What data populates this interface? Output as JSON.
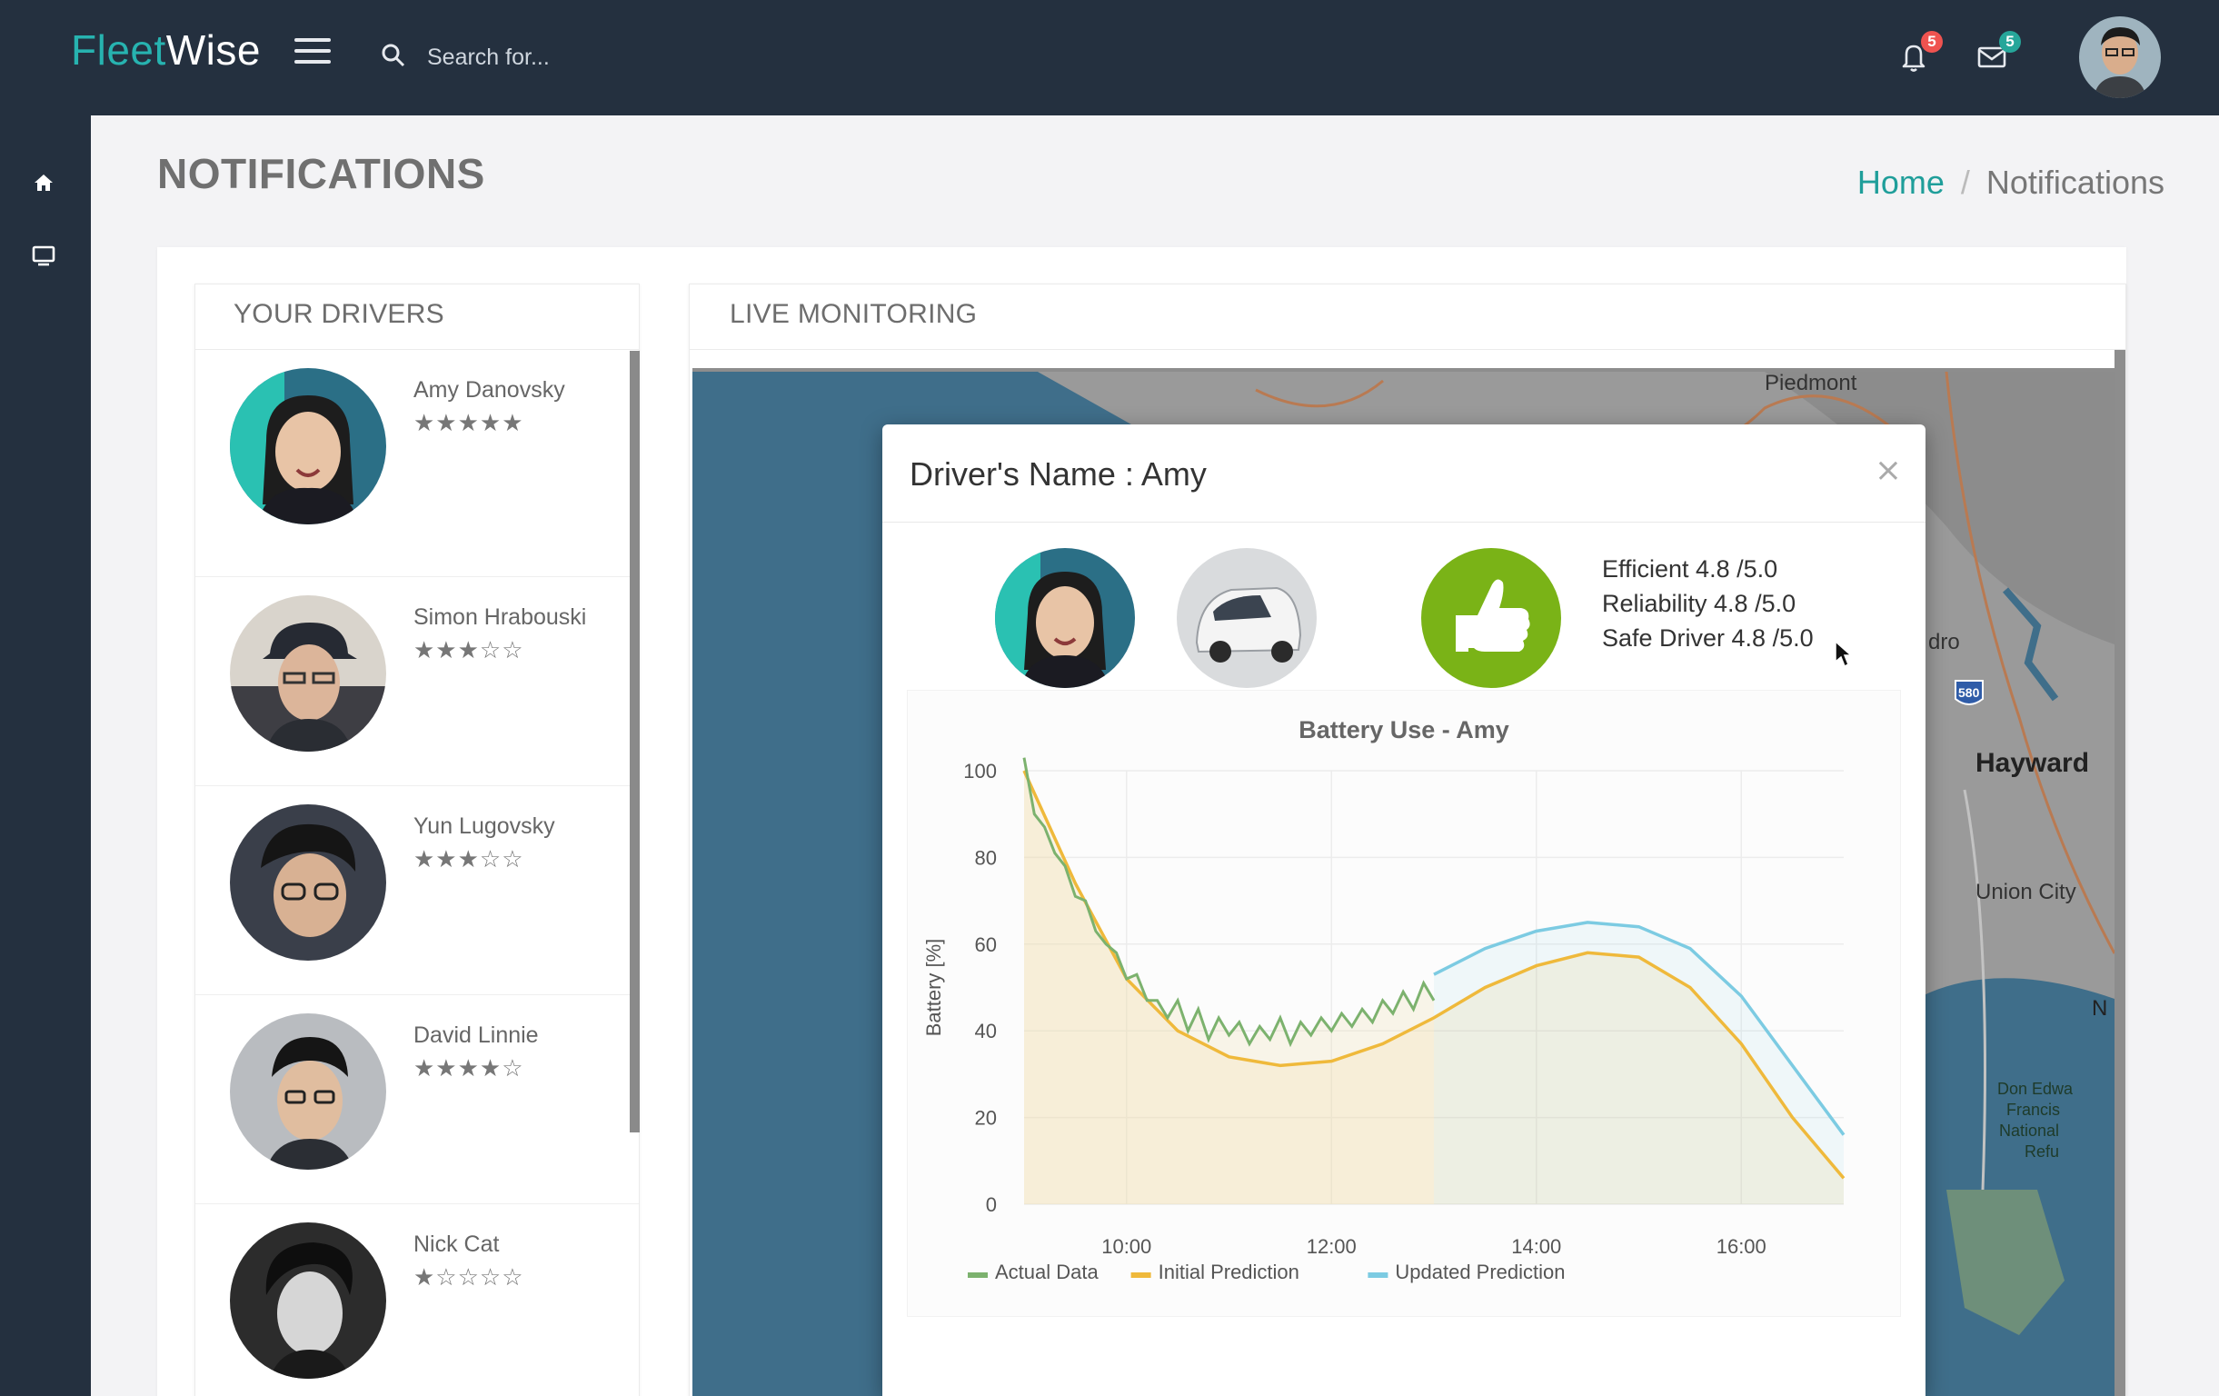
{
  "header": {
    "brand_part1": "Fleet",
    "brand_part2": "Wise",
    "search_placeholder": "Search for...",
    "notifications_count": "5",
    "messages_count": "5"
  },
  "page": {
    "title": "NOTIFICATIONS",
    "breadcrumb_home": "Home",
    "breadcrumb_sep": "/",
    "breadcrumb_current": "Notifications"
  },
  "drivers_panel": {
    "title": "YOUR DRIVERS",
    "drivers": [
      {
        "name": "Amy Danovsky",
        "rating": 5,
        "stars": "★★★★★"
      },
      {
        "name": "Simon Hrabouski",
        "rating": 3,
        "stars": "★★★☆☆"
      },
      {
        "name": "Yun Lugovsky",
        "rating": 3,
        "stars": "★★★☆☆"
      },
      {
        "name": "David Linnie",
        "rating": 4,
        "stars": "★★★★☆"
      },
      {
        "name": "Nick Cat",
        "rating": 1,
        "stars": "★☆☆☆☆"
      }
    ]
  },
  "live_panel": {
    "title": "LIVE MONITORING",
    "map_labels": [
      "Piedmont",
      "dro",
      "580",
      "Hayward",
      "Union City",
      "N",
      "Don Edwa",
      "Francis",
      "National",
      "Refu"
    ]
  },
  "modal": {
    "title": "Driver's Name : Amy",
    "close": "×",
    "scores": [
      "Efficient 4.8 /5.0",
      "Reliability 4.8 /5.0",
      "Safe Driver 4.8 /5.0"
    ]
  },
  "colors": {
    "topbar": "#24303f",
    "brand_accent": "#27b3b0",
    "actual": "#7cb26e",
    "initial": "#efb93b",
    "updated": "#7ccbe2",
    "thumb": "#7ab317"
  },
  "chart_data": {
    "type": "line",
    "title": "Battery Use - Amy",
    "xlabel": "",
    "ylabel": "Battery [%]",
    "ylim": [
      0,
      100
    ],
    "xlim": [
      9.0,
      17.0
    ],
    "yticks": [
      0,
      20,
      40,
      60,
      80,
      100
    ],
    "xticks": [
      {
        "v": 10,
        "label": "10:00"
      },
      {
        "v": 12,
        "label": "12:00"
      },
      {
        "v": 14,
        "label": "14:00"
      },
      {
        "v": 16,
        "label": "16:00"
      }
    ],
    "legend_position": "bottom-left",
    "series": [
      {
        "name": "Actual Data",
        "color": "#7cb26e",
        "x": [
          9.0,
          9.1,
          9.2,
          9.3,
          9.4,
          9.5,
          9.6,
          9.7,
          9.8,
          9.9,
          10.0,
          10.1,
          10.2,
          10.3,
          10.4,
          10.5,
          10.6,
          10.7,
          10.8,
          10.9,
          11.0,
          11.1,
          11.2,
          11.3,
          11.4,
          11.5,
          11.6,
          11.7,
          11.8,
          11.9,
          12.0,
          12.1,
          12.2,
          12.3,
          12.4,
          12.5,
          12.6,
          12.7,
          12.8,
          12.9,
          13.0
        ],
        "y": [
          103,
          90,
          87,
          81,
          78,
          71,
          70,
          63,
          60,
          58,
          52,
          53,
          47,
          47,
          43,
          47,
          40,
          45,
          38,
          43,
          39,
          42,
          37,
          41,
          38,
          43,
          37,
          42,
          39,
          43,
          40,
          44,
          41,
          45,
          42,
          47,
          44,
          49,
          45,
          51,
          47
        ]
      },
      {
        "name": "Initial Prediction",
        "color": "#efb93b",
        "x": [
          9.0,
          9.5,
          10.0,
          10.5,
          11.0,
          11.5,
          12.0,
          12.5,
          13.0,
          13.5,
          14.0,
          14.5,
          15.0,
          15.5,
          16.0,
          16.5,
          17.0
        ],
        "y": [
          100,
          74,
          52,
          40,
          34,
          32,
          33,
          37,
          43,
          50,
          55,
          58,
          57,
          50,
          37,
          20,
          6
        ]
      },
      {
        "name": "Updated Prediction",
        "color": "#7ccbe2",
        "x": [
          13.0,
          13.5,
          14.0,
          14.5,
          15.0,
          15.5,
          16.0,
          16.5,
          17.0
        ],
        "y": [
          53,
          59,
          63,
          65,
          64,
          59,
          48,
          32,
          16
        ]
      }
    ]
  }
}
